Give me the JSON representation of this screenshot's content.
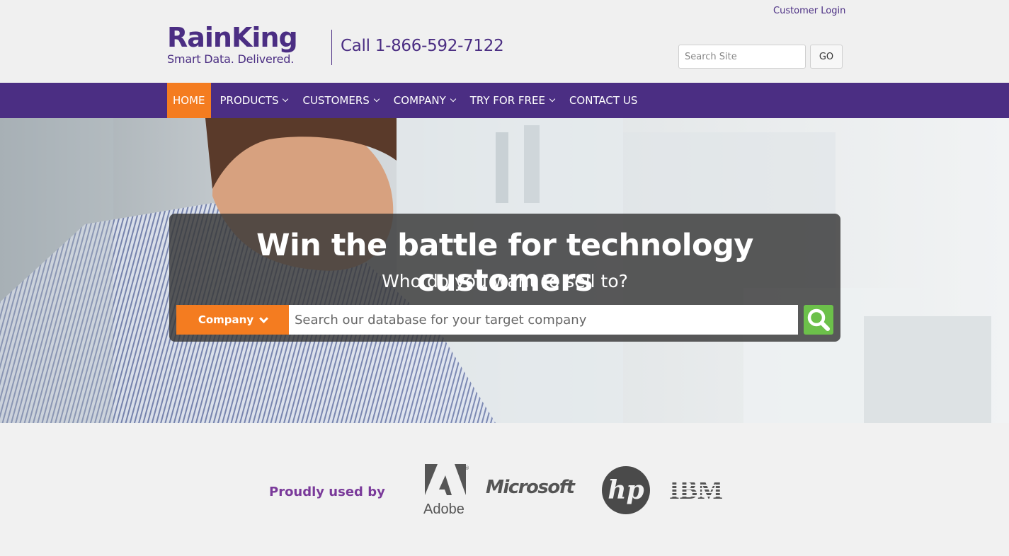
{
  "header": {
    "customer_login": "Customer Login",
    "logo_word": "RainKing",
    "logo_tagline": "Smart Data. Delivered.",
    "phone": "Call 1-866-592-7122",
    "search_placeholder": "Search Site",
    "go_label": "GO"
  },
  "nav": {
    "items": [
      {
        "label": "HOME",
        "active": true
      },
      {
        "label": "PRODUCTS",
        "dropdown": true
      },
      {
        "label": "CUSTOMERS",
        "dropdown": true
      },
      {
        "label": "COMPANY",
        "dropdown": true
      },
      {
        "label": "TRY FOR FREE",
        "dropdown": true
      },
      {
        "label": "CONTACT US"
      }
    ]
  },
  "hero": {
    "headline": "Win the battle for technology customers",
    "subhead": "Who do you want to sell to?",
    "search_type": "Company",
    "search_placeholder": "Search our database for your target company",
    "search_icon": "search-icon"
  },
  "clients": {
    "label": "Proudly used by",
    "logos": [
      "Adobe",
      "Microsoft",
      "hp",
      "IBM"
    ]
  },
  "colors": {
    "brand_purple": "#4b2e83",
    "accent_orange": "#f47c20",
    "search_green": "#6cc04a"
  }
}
